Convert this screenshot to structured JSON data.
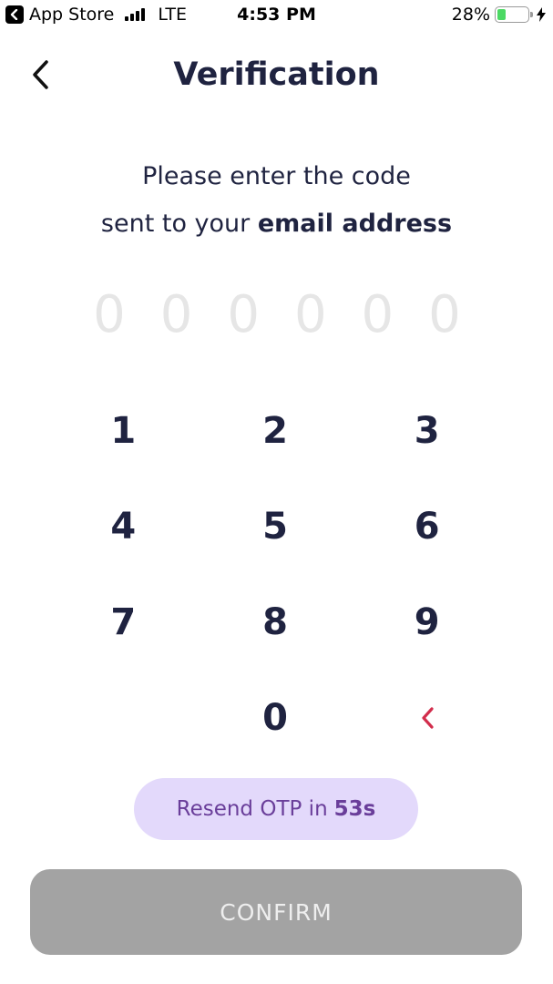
{
  "status_bar": {
    "back_app": "App Store",
    "network": "LTE",
    "time": "4:53 PM",
    "battery_percent": "28%",
    "battery_level": 0.28
  },
  "header": {
    "title": "Verification",
    "back_icon": "chevron-left-icon"
  },
  "instruction": {
    "line1": "Please enter the code",
    "line2_prefix": "sent to your",
    "line2_bold": "email address"
  },
  "otp": {
    "placeholders": [
      "0",
      "0",
      "0",
      "0",
      "0",
      "0"
    ]
  },
  "keypad": {
    "keys": [
      "1",
      "2",
      "3",
      "4",
      "5",
      "6",
      "7",
      "8",
      "9",
      "",
      "0"
    ],
    "delete_icon": "backspace-chevron-icon",
    "delete_color": "#d22d4c"
  },
  "resend": {
    "prefix": "Resend OTP in",
    "countdown": "53s"
  },
  "confirm": {
    "label": "CONFIRM"
  },
  "colors": {
    "title": "#1f2340",
    "placeholder": "#e6e6e6",
    "resend_bg": "#e3d9fb",
    "resend_text": "#6a3e9a",
    "confirm_bg": "#a3a3a3",
    "battery": "#4cd964"
  }
}
